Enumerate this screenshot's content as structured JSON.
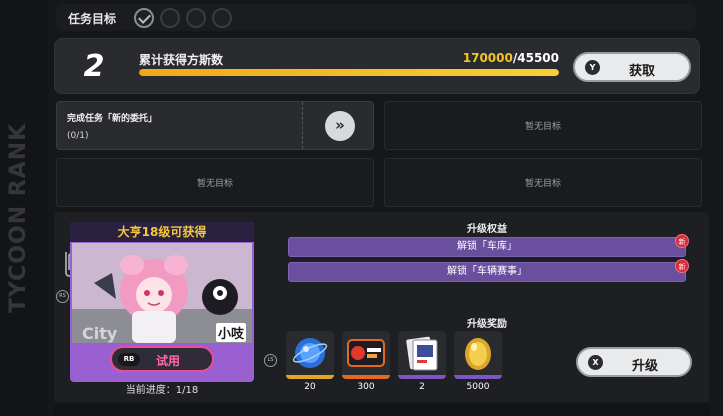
{
  "side_label": "TYCOON RANK",
  "task_bar": {
    "label": "任务目标",
    "checks": [
      true,
      false,
      false,
      false
    ]
  },
  "points": {
    "level": "2",
    "label": "累计获得方斯数",
    "current": "170000",
    "total": "/45500",
    "fill_fraction": 1.0,
    "claim_key": "Y",
    "claim_label": "获取"
  },
  "goals": [
    {
      "title": "完成任务「新的委托」",
      "progress": "(0/1)",
      "goto_icon": "»"
    },
    {
      "empty_text": "暂无目标"
    },
    {
      "empty_text": "暂无目标"
    },
    {
      "empty_text": "暂无目标"
    }
  ],
  "card": {
    "banner": "大亨18级可获得",
    "name": "小吱",
    "trial_key": "RB",
    "trial_label": "试用",
    "progress_text": "当前进度：1/18",
    "stamp": "City"
  },
  "markers": {
    "rs": "RS",
    "ls": "LS"
  },
  "benefits": {
    "title": "升级权益",
    "items": [
      {
        "label": "解锁「车库」",
        "badge": "新"
      },
      {
        "label": "解锁「车辆赛事」",
        "badge": "新"
      }
    ]
  },
  "rewards": {
    "title": "升级奖励",
    "items": [
      {
        "icon": "blue-orb-icon",
        "count": "20",
        "rarity": "gold"
      },
      {
        "icon": "racing-ticket-icon",
        "count": "300",
        "rarity": "orange"
      },
      {
        "icon": "card-pack-icon",
        "count": "2",
        "rarity": "purple"
      },
      {
        "icon": "gold-egg-icon",
        "count": "5000",
        "rarity": "purple"
      }
    ]
  },
  "upgrade": {
    "key": "X",
    "label": "升级"
  },
  "colors": {
    "accent_yellow": "#f3c628",
    "accent_purple": "#6a4f9f",
    "badge_red": "#d92a3a",
    "trial_pink": "#e94f93"
  }
}
